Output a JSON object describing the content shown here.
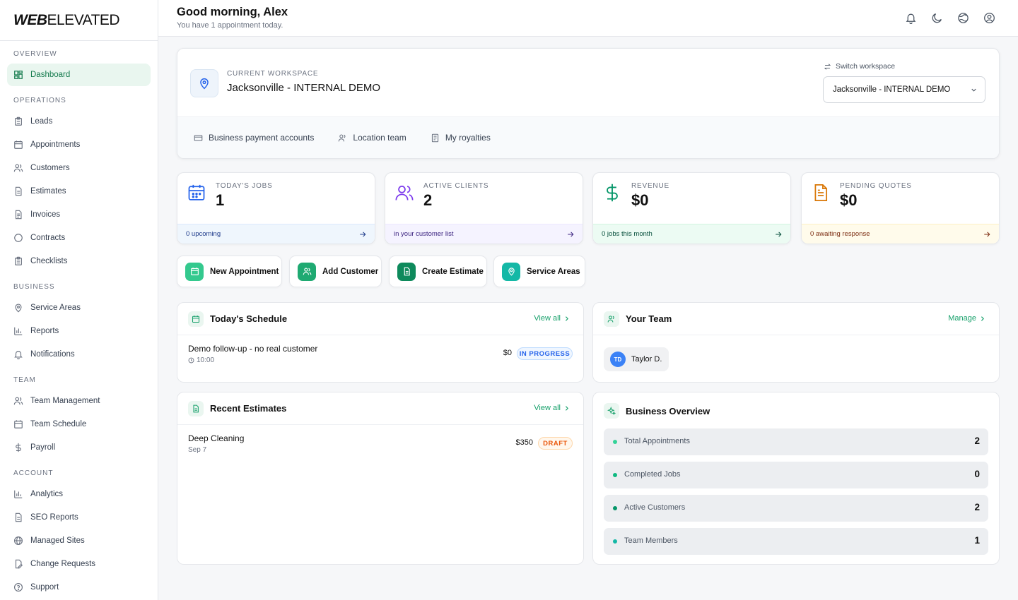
{
  "brand": {
    "logo_bold": "WEB",
    "logo_light": "ELEVATED"
  },
  "sidebar": {
    "sections": {
      "overview": "OVERVIEW",
      "operations": "OPERATIONS",
      "business": "BUSINESS",
      "team": "TEAM",
      "account": "ACCOUNT"
    },
    "items": {
      "dashboard": "Dashboard",
      "leads": "Leads",
      "appointments": "Appointments",
      "customers": "Customers",
      "estimates": "Estimates",
      "invoices": "Invoices",
      "contracts": "Contracts",
      "checklists": "Checklists",
      "service_areas": "Service Areas",
      "reports": "Reports",
      "notifications": "Notifications",
      "team_management": "Team Management",
      "team_schedule": "Team Schedule",
      "payroll": "Payroll",
      "analytics": "Analytics",
      "seo_reports": "SEO Reports",
      "managed_sites": "Managed Sites",
      "change_requests": "Change Requests",
      "support": "Support"
    }
  },
  "header": {
    "greeting": "Good morning, Alex",
    "subtitle": "You have 1 appointment today.",
    "icons": [
      "bell-icon",
      "moon-icon",
      "globe-icon",
      "user-circle-icon"
    ]
  },
  "workspace": {
    "label": "CURRENT WORKSPACE",
    "name": "Jacksonville - INTERNAL DEMO",
    "switch_label": "Switch workspace",
    "selected": "Jacksonville - INTERNAL DEMO",
    "links": {
      "payment_accounts": "Business payment accounts",
      "location_team": "Location team",
      "royalties": "My royalties"
    }
  },
  "stats": {
    "jobs": {
      "label": "TODAY'S JOBS",
      "value": "1",
      "footer": "0 upcoming",
      "color": "#2563eb"
    },
    "clients": {
      "label": "ACTIVE CLIENTS",
      "value": "2",
      "footer": "in your customer list",
      "color": "#7c3aed"
    },
    "revenue": {
      "label": "REVENUE",
      "value": "$0",
      "footer": "0 jobs this month",
      "color": "#059669"
    },
    "quotes": {
      "label": "PENDING QUOTES",
      "value": "$0",
      "footer": "0 awaiting response",
      "color": "#d97706"
    }
  },
  "quick_actions": {
    "new_appointment": "New Appointment",
    "add_customer": "Add Customer",
    "create_estimate": "Create Estimate",
    "service_areas": "Service Areas"
  },
  "schedule": {
    "title": "Today's Schedule",
    "link": "View all",
    "items": [
      {
        "title": "Demo follow-up - no real customer",
        "time": "10:00",
        "amount": "$0",
        "status": "IN PROGRESS"
      }
    ]
  },
  "team": {
    "title": "Your Team",
    "link": "Manage",
    "members": [
      {
        "initials": "TD",
        "name": "Taylor D."
      }
    ]
  },
  "estimates": {
    "title": "Recent Estimates",
    "link": "View all",
    "items": [
      {
        "title": "Deep Cleaning",
        "date": "Sep 7",
        "amount": "$350",
        "status": "DRAFT"
      }
    ]
  },
  "overview": {
    "title": "Business Overview",
    "items": [
      {
        "label": "Total Appointments",
        "value": "2"
      },
      {
        "label": "Completed Jobs",
        "value": "0"
      },
      {
        "label": "Active Customers",
        "value": "2"
      },
      {
        "label": "Team Members",
        "value": "1"
      }
    ]
  }
}
